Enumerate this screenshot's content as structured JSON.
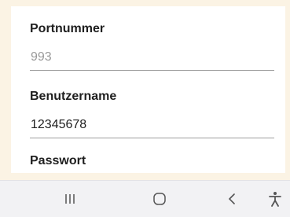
{
  "form": {
    "port": {
      "label": "Portnummer",
      "value": "",
      "placeholder": "993"
    },
    "username": {
      "label": "Benutzername",
      "value": "12345678",
      "placeholder": ""
    },
    "password": {
      "label": "Passwort"
    }
  },
  "navbar": {
    "buttons": [
      {
        "name": "recents",
        "icon": "recents-icon"
      },
      {
        "name": "home",
        "icon": "home-icon"
      },
      {
        "name": "back",
        "icon": "back-icon"
      },
      {
        "name": "accessibility",
        "icon": "accessibility-icon"
      }
    ]
  },
  "colors": {
    "background": "#fbf3e4",
    "card": "#ffffff",
    "navbar": "#f2f2f4",
    "icon": "#555555"
  }
}
